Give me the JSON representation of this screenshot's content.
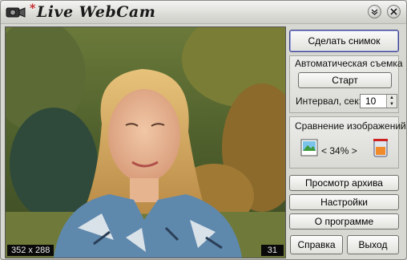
{
  "window": {
    "title_mark": "*",
    "title": "Live WebCam"
  },
  "video": {
    "resolution": "352 x 288",
    "counter": "31"
  },
  "buttons": {
    "snapshot": "Сделать снимок",
    "start": "Старт",
    "archive": "Просмотр архива",
    "settings": "Настройки",
    "about": "О программе",
    "help": "Справка",
    "exit": "Выход"
  },
  "auto_capture": {
    "heading": "Автоматическая съемка",
    "interval_label": "Интервал, сек:",
    "interval_value": "10"
  },
  "compare": {
    "heading": "Сравнение изображений",
    "value": "< 34% >"
  },
  "colors": {
    "title_accent": "#c4171c",
    "panel_bg": "#dadad5",
    "primary_border": "#3c3c8c"
  },
  "icons": [
    "camera-icon",
    "minimize-icon",
    "close-icon",
    "landscape-image-icon",
    "trash-icon"
  ]
}
